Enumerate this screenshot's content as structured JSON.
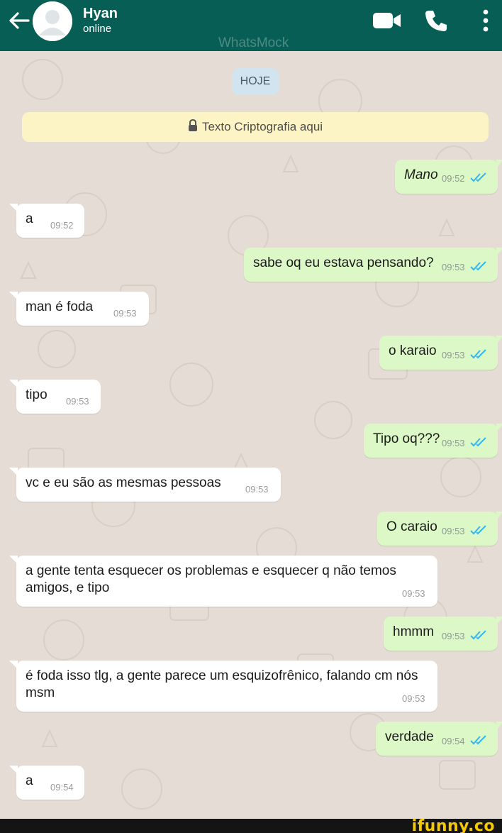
{
  "header": {
    "contact_name": "Hyan",
    "contact_status": "online",
    "watermark": "WhatsMock",
    "bg_color": "#075e54"
  },
  "icons": {
    "back": "arrow-left-icon",
    "avatar": "default-avatar-icon",
    "video": "video-camera-icon",
    "call": "phone-icon",
    "more": "more-vertical-icon",
    "lock": "lock-icon",
    "read": "double-check-icon"
  },
  "chat": {
    "date_label": "HOJE",
    "encryption_notice": "Texto Criptografia aqui",
    "messages": [
      {
        "dir": "out",
        "text": "Mano",
        "time": "09:52",
        "read": true
      },
      {
        "dir": "in",
        "text": "a",
        "time": "09:52"
      },
      {
        "dir": "out",
        "text": "sabe oq eu estava pensando?",
        "time": "09:53",
        "read": true
      },
      {
        "dir": "in",
        "text": "man é foda",
        "time": "09:53"
      },
      {
        "dir": "out",
        "text": "o karaio",
        "time": "09:53",
        "read": true
      },
      {
        "dir": "in",
        "text": "tipo",
        "time": "09:53"
      },
      {
        "dir": "out",
        "text": "Tipo oq???",
        "time": "09:53",
        "read": true
      },
      {
        "dir": "in",
        "text": "vc e eu são as mesmas pessoas",
        "time": "09:53"
      },
      {
        "dir": "out",
        "text": "O caraio",
        "time": "09:53",
        "read": true
      },
      {
        "dir": "in",
        "text": "a gente tenta esquecer os problemas e esquecer q não temos amigos, e tipo",
        "time": "09:53"
      },
      {
        "dir": "out",
        "text": "hmmm",
        "time": "09:53",
        "read": true
      },
      {
        "dir": "in",
        "text": "é foda isso tlg, a gente parece um esquizofrênico, falando cm nós msm",
        "time": "09:53"
      },
      {
        "dir": "out",
        "text": "verdade",
        "time": "09:54",
        "read": true
      },
      {
        "dir": "in",
        "text": "a",
        "time": "09:54"
      }
    ]
  },
  "footer": {
    "brand": "ifunny.co"
  },
  "colors": {
    "outgoing_bubble": "#dcf8c6",
    "incoming_bubble": "#ffffff",
    "read_ticks": "#34b7f1",
    "chat_bg": "#e5ddd5"
  }
}
